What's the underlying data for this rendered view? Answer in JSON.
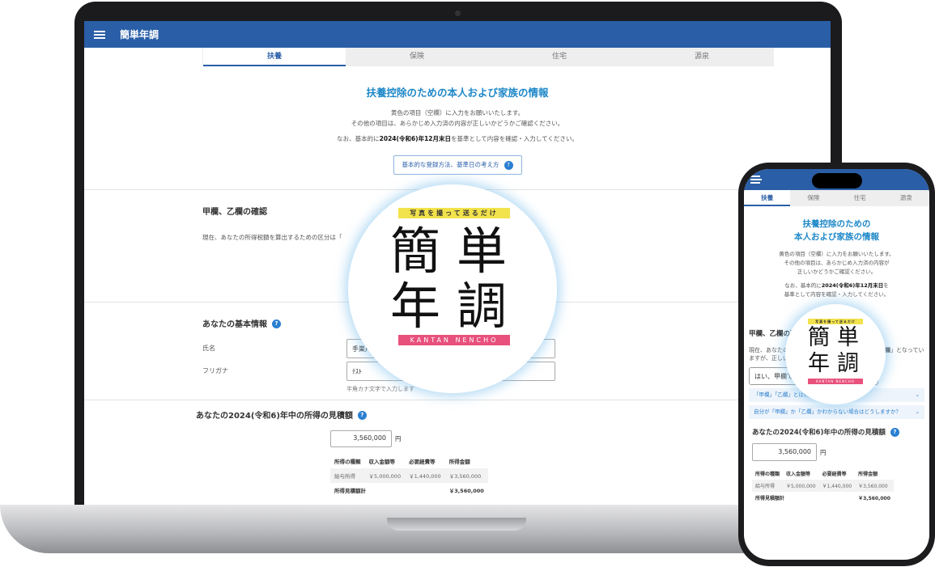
{
  "app": {
    "title": "簡単年調"
  },
  "tabs": [
    {
      "label": "扶養",
      "active": true
    },
    {
      "label": "保険"
    },
    {
      "label": "住宅"
    },
    {
      "label": "源泉"
    }
  ],
  "intro": {
    "title": "扶養控除のための本人および家族の情報",
    "line1": "黄色の項目（空欄）に入力をお願いいたします。",
    "line2": "その他の項目は、あらかじめ入力済の内容が正しいかどうかご確認ください。",
    "line3_pre": "なお、基本的に",
    "line3_bold": "2024(令和6)年12月末日",
    "line3_post": "を基準として内容を確認・入力してください。",
    "guide_button": "基本的な登録方法、基準日の考え方"
  },
  "section_kouotsu": {
    "title": "甲欄、乙欄の確認",
    "text": "現在、あなたの所得税額を算出するための区分は「"
  },
  "section_basic": {
    "title": "あなたの基本情報",
    "name_label": "氏名",
    "name_value": "手巣戸",
    "kana_label": "フリガナ",
    "kana_value": "ﾃｽﾄ",
    "kana_hint": "半角カナ文字で入力します"
  },
  "income": {
    "title": "あなたの2024(令和6)年中の所得の見積額",
    "amount": "3,560,000",
    "unit": "円",
    "headers": [
      "所得の種類",
      "収入金額等",
      "必要経費等",
      "所得金額"
    ],
    "row": [
      "給与所得",
      "￥5,000,000",
      "￥1,440,000",
      "￥3,560,000"
    ],
    "total_label": "所得見積額計",
    "total_value": "￥3,560,000"
  },
  "logo": {
    "tagline": "写真を撮って送るだけ",
    "chars": [
      "簡",
      "単",
      "年",
      "調"
    ],
    "romaji": "KANTAN NENCHO"
  },
  "phone": {
    "title_line1": "扶養控除のための",
    "title_line2": "本人および家族の情報",
    "p1": "黄色の項目（空欄）に入力をお願いいたします。",
    "p2": "その他の項目は、あらかじめ入力済の内容が",
    "p3": "正しいかどうかご確認ください。",
    "p4_pre": "なお、基本的に",
    "p4_bold": "2024(令和6)年12月末日",
    "p4_post": "を",
    "p5": "基準として内容を確認・入力してください。",
    "kouotsu_title": "甲欄、乙欄の確認",
    "kouotsu_text_pre": "現在、あなたの所得税額を算出するための区分は「",
    "kouotsu_text_bold": "甲欄",
    "kouotsu_text_post": "」となっていますが、正しいですか？",
    "select_value": "はい、甲欄で正しいです",
    "link1": "「甲欄」「乙欄」とは何ですか？",
    "link2": "自分が「甲欄」か「乙欄」かわからない場合はどうしますか？",
    "income_title": "あなたの2024(令和6)年中の所得の見積額",
    "amount": "3,560,000",
    "unit": "円",
    "headers": [
      "所得の種類",
      "収入金額等",
      "必要経費等",
      "所得金額"
    ],
    "row": [
      "給与所得",
      "￥5,000,000",
      "￥1,440,000",
      "￥3,560,000"
    ],
    "total_label": "所得見積額計",
    "total_value": "￥3,560,000"
  }
}
